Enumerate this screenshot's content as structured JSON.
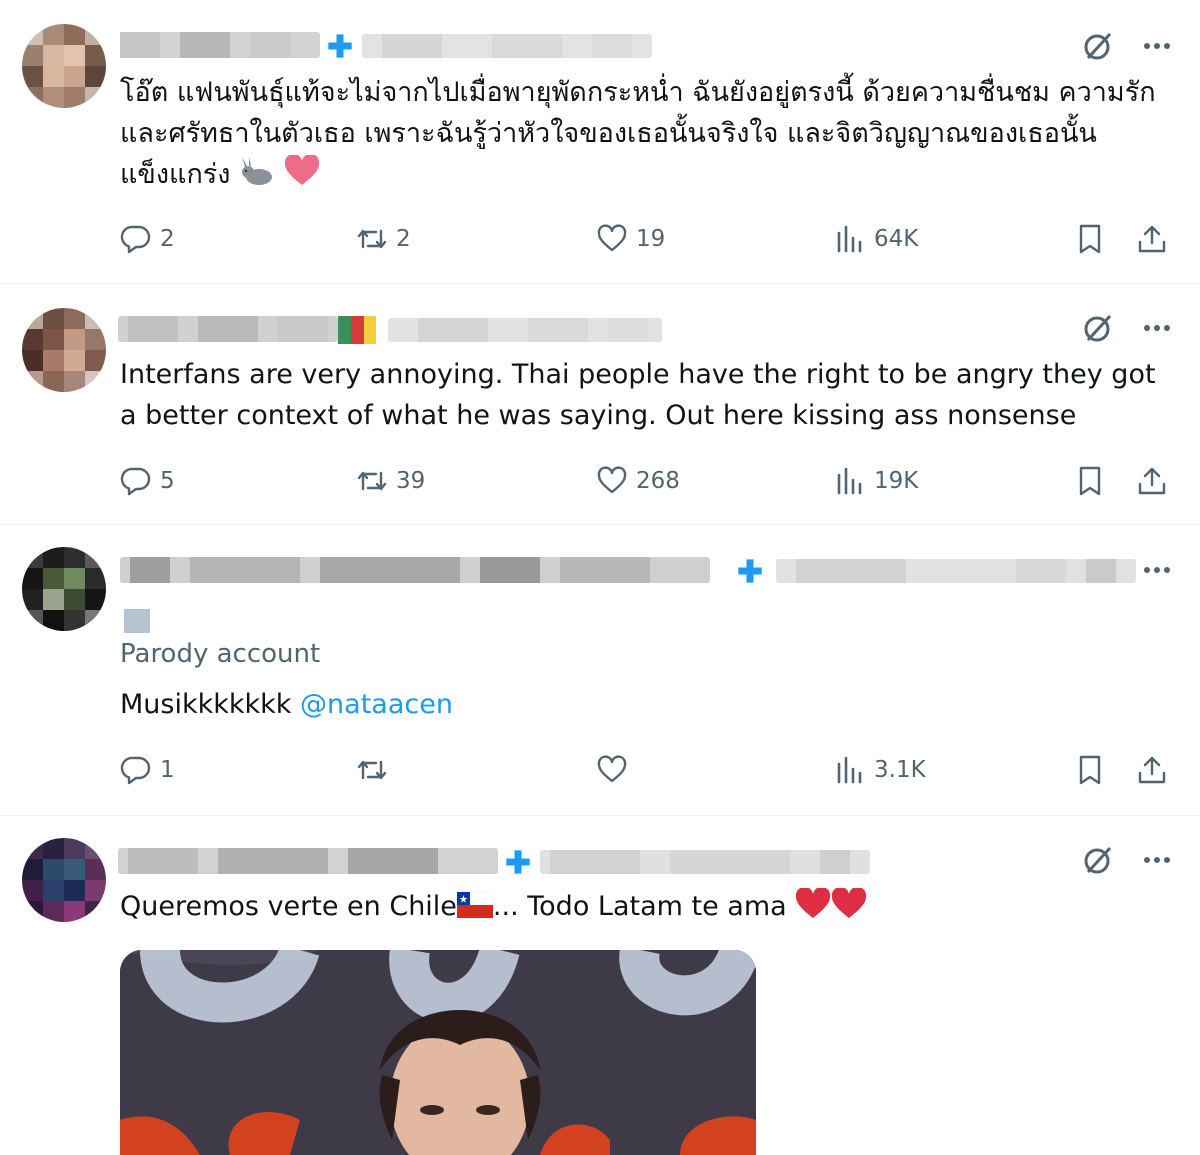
{
  "colors": {
    "text": "#0f1419",
    "muted": "#536471",
    "accent": "#1d9bf0",
    "heart": "#f4245e"
  },
  "tweets": [
    {
      "text": "โอ๊ต แฟนพันธุ์แท้จะไม่จากไปเมื่อพายุพัดกระหน่ำ ฉันยังอยู่ตรงนี้ ด้วยความชื่นชม ความรัก และศรัทธาในตัวเธอ เพราะฉันรู้ว่าหัวใจของเธอนั้นจริงใจ และจิตวิญญาณของเธอนั้นแข็งแกร่ง",
      "emojis": [
        "rabbit-emoji",
        "pink-heart-emoji"
      ],
      "replies": "2",
      "reposts": "2",
      "likes": "19",
      "views": "64K"
    },
    {
      "text": "Interfans are very annoying. Thai people have the right to be angry they got a better context of what he was saying. Out here kissing ass nonsense",
      "replies": "5",
      "reposts": "39",
      "likes": "268",
      "views": "19K"
    },
    {
      "parody_label": "Parody account",
      "text": "Musikkkkkkk",
      "mention": "@nataacen",
      "replies": "1",
      "reposts": "",
      "likes": "",
      "views": "3.1K"
    },
    {
      "text_before": "Queremos verte en Chile",
      "text_after": "... Todo Latam te ama",
      "emojis": [
        "chile-flag-emoji",
        "red-heart-emoji",
        "red-heart-emoji"
      ]
    }
  ],
  "icons": {
    "grok": "grok-icon",
    "more": "more-icon",
    "reply": "reply-icon",
    "repost": "repost-icon",
    "like": "like-icon",
    "views": "views-icon",
    "bookmark": "bookmark-icon",
    "share": "share-icon"
  }
}
